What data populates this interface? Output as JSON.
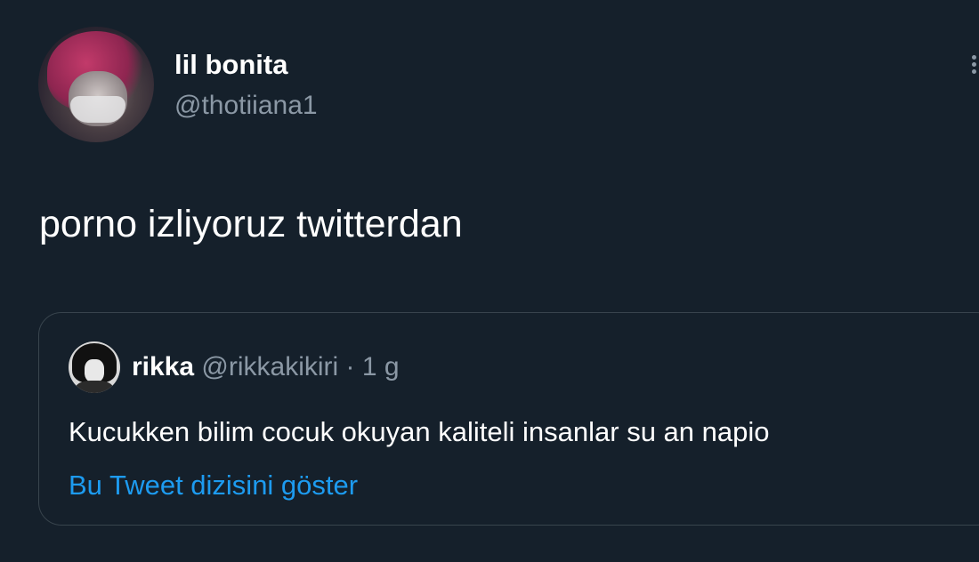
{
  "tweet": {
    "author": {
      "display_name": "lil bonita",
      "handle": "@thotiiana1"
    },
    "text": "porno izliyoruz twitterdan",
    "more_icon": "more-vertical-icon"
  },
  "quoted_tweet": {
    "author": {
      "display_name": "rikka",
      "handle": "@rikkakikiri"
    },
    "separator": "·",
    "time": "1 g",
    "text": "Kucukken bilim cocuk okuyan kaliteli insanlar su an napio",
    "show_thread_link": "Bu Tweet dizisini göster"
  },
  "colors": {
    "background": "#15202b",
    "text_primary": "#ffffff",
    "text_secondary": "#8b98a5",
    "link": "#1d9bf0",
    "border": "#38444d"
  }
}
